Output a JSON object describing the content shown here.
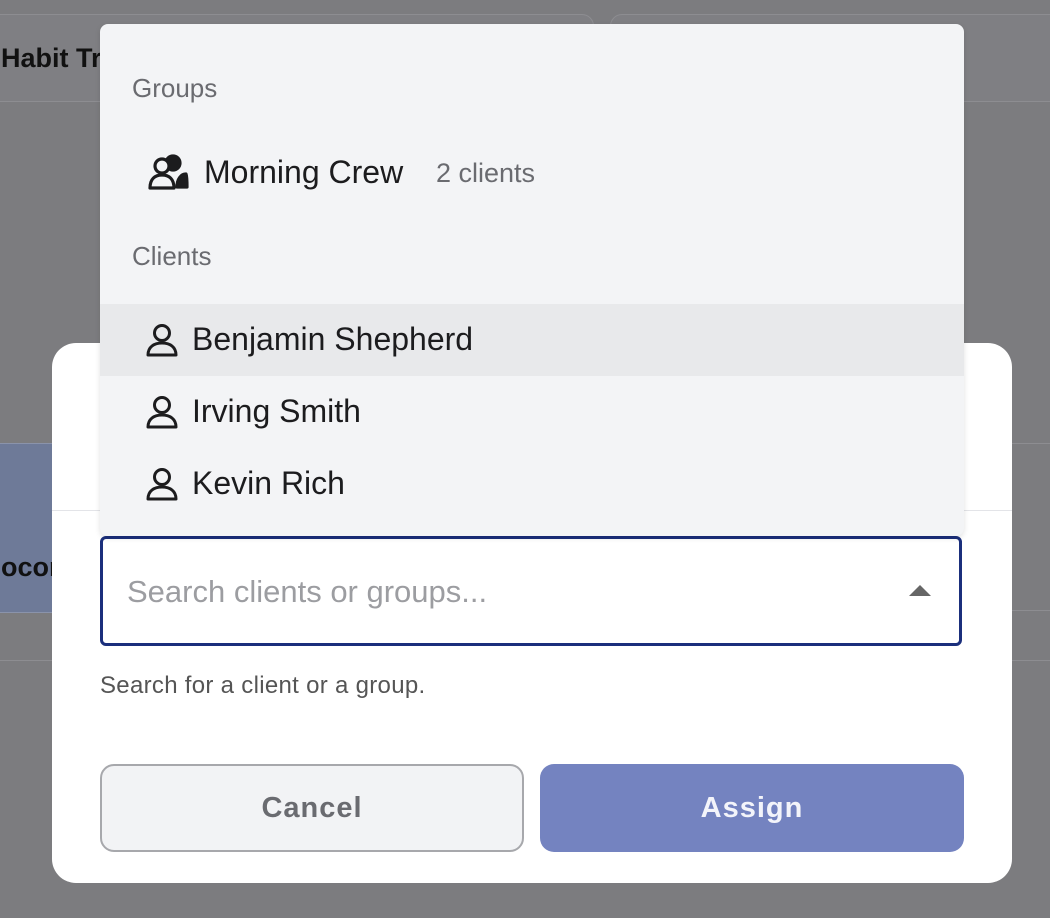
{
  "background": {
    "card_title": "Habit Tr",
    "row_text": "ocon"
  },
  "dropdown": {
    "groups_label": "Groups",
    "groups": [
      {
        "name": "Morning Crew",
        "count": "2 clients",
        "icon": "users-icon"
      }
    ],
    "clients_label": "Clients",
    "clients": [
      {
        "name": "Benjamin Shepherd",
        "icon": "user-icon",
        "highlighted": true
      },
      {
        "name": "Irving Smith",
        "icon": "user-icon",
        "highlighted": false
      },
      {
        "name": "Kevin Rich",
        "icon": "user-icon",
        "highlighted": false
      }
    ]
  },
  "search": {
    "value": "",
    "placeholder": "Search clients or groups...",
    "helper": "Search for a client or a group."
  },
  "actions": {
    "cancel_label": "Cancel",
    "assign_label": "Assign"
  },
  "colors": {
    "accent_border": "#1b2f7c",
    "assign_button": "#7483c0",
    "highlight_row": "#e8e9eb",
    "dropdown_bg": "#f3f4f6"
  }
}
